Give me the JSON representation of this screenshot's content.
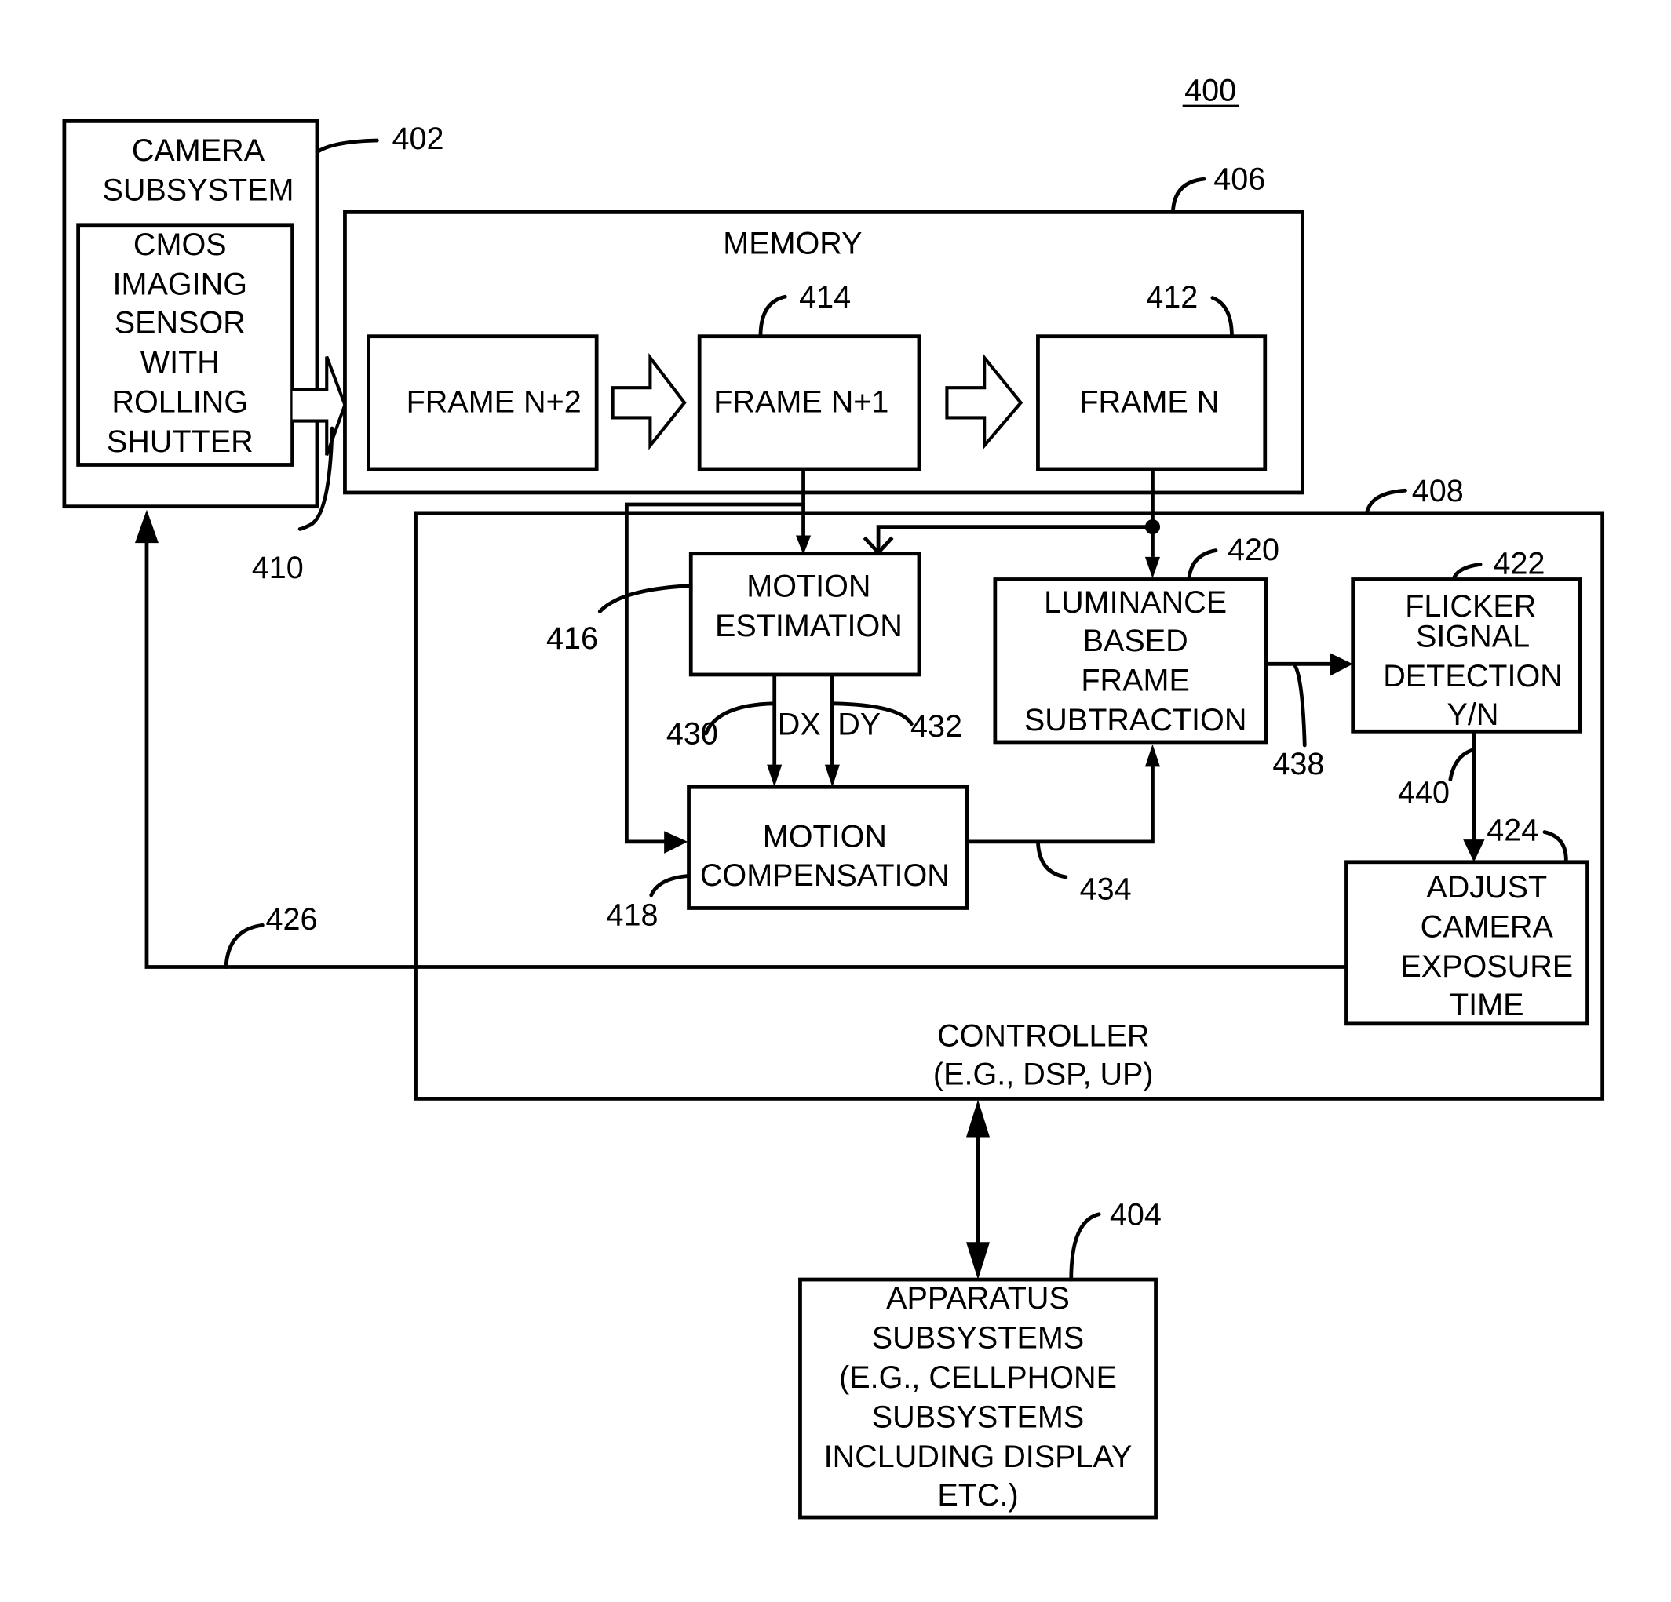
{
  "figure": {
    "number": "400",
    "blocks": {
      "camera": {
        "ref": "402",
        "title": [
          "CAMERA",
          "SUBSYSTEM"
        ]
      },
      "sensor": {
        "lines": [
          "CMOS",
          "IMAGING",
          "SENSOR",
          "WITH",
          "ROLLING",
          "SHUTTER"
        ]
      },
      "memory": {
        "ref": "406",
        "title": "MEMORY"
      },
      "frame_n2": {
        "label": "FRAME N+2"
      },
      "frame_n1": {
        "ref": "414",
        "label": "FRAME N+1"
      },
      "frame_n": {
        "ref": "412",
        "label": "FRAME N"
      },
      "controller": {
        "ref": "408",
        "title": [
          "CONTROLLER",
          "(E.G., DSP, UP)"
        ]
      },
      "motion_estimation": {
        "ref": "416",
        "lines": [
          "MOTION",
          "ESTIMATION"
        ]
      },
      "motion_compensation": {
        "ref": "418",
        "lines": [
          "MOTION",
          "COMPENSATION"
        ]
      },
      "luminance": {
        "ref": "420",
        "lines": [
          "LUMINANCE",
          "BASED",
          "FRAME",
          "SUBTRACTION"
        ]
      },
      "flicker": {
        "ref": "422",
        "lines": [
          "FLICKER",
          "SIGNAL",
          "DETECTION",
          "Y/N"
        ]
      },
      "adjust": {
        "ref": "424",
        "lines": [
          "ADJUST",
          "CAMERA",
          "EXPOSURE",
          "TIME"
        ]
      },
      "apparatus": {
        "ref": "404",
        "lines": [
          "APPARATUS",
          "SUBSYSTEMS",
          "(E.G., CELLPHONE",
          "SUBSYSTEMS",
          "INCLUDING DISPLAY",
          "ETC.)"
        ]
      }
    },
    "signals": {
      "sensor_out": {
        "ref": "410"
      },
      "dx": {
        "ref": "430",
        "label": "DX"
      },
      "dy": {
        "ref": "432",
        "label": "DY"
      },
      "comp_out": {
        "ref": "434"
      },
      "sub_out": {
        "ref": "438"
      },
      "flicker_out": {
        "ref": "440"
      },
      "feedback": {
        "ref": "426"
      }
    }
  }
}
